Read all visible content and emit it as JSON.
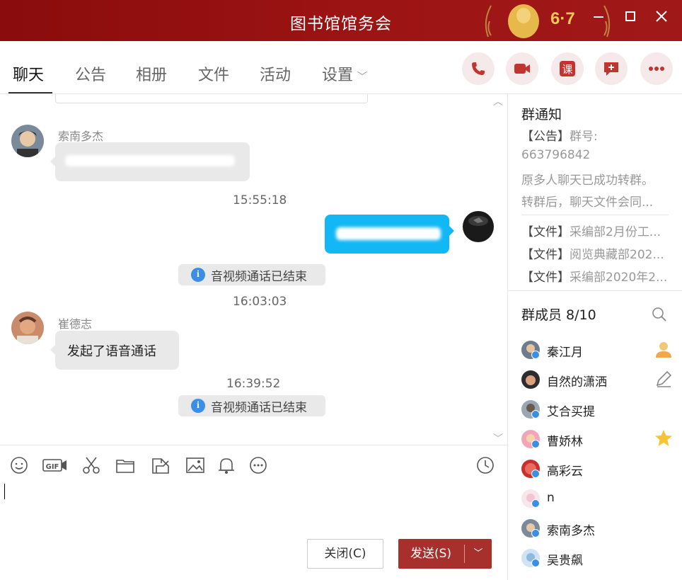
{
  "window": {
    "title": "图书馆馆务会",
    "badge": "6·7"
  },
  "tabs": [
    {
      "label": "聊天"
    },
    {
      "label": "公告"
    },
    {
      "label": "相册"
    },
    {
      "label": "文件"
    },
    {
      "label": "活动"
    },
    {
      "label": "设置"
    }
  ],
  "chat": {
    "messages": [
      {
        "sender": "索南多杰"
      },
      {
        "time": "15:55:18"
      },
      {
        "system": "音视频通话已结束"
      },
      {
        "time": "16:03:03"
      },
      {
        "sender": "崔德志",
        "text": "发起了语音通话"
      },
      {
        "time": "16:39:52"
      },
      {
        "system": "音视频通话已结束"
      }
    ]
  },
  "composer": {
    "close_label": "关闭(C)",
    "send_label": "发送(S)"
  },
  "notice": {
    "title": "群通知",
    "lines": [
      {
        "tag": "【公告】",
        "text": "群号:"
      },
      {
        "tag": "",
        "text": "663796842"
      },
      {
        "tag": "",
        "text": "原多人聊天已成功转群。"
      },
      {
        "tag": "",
        "text": "转群后，聊天文件会同..."
      }
    ],
    "files": [
      {
        "tag": "【文件】",
        "text": "采编部2月份工..."
      },
      {
        "tag": "【文件】",
        "text": "阅览典藏部202..."
      },
      {
        "tag": "【文件】",
        "text": "采编部2020年2..."
      }
    ]
  },
  "members": {
    "title": "群成员 8/10",
    "list": [
      {
        "name": "秦江月",
        "role": "owner"
      },
      {
        "name": "自然的潇洒",
        "role": "editor"
      },
      {
        "name": "艾合买提",
        "role": ""
      },
      {
        "name": "曹娇林",
        "role": "star"
      },
      {
        "name": "高彩云",
        "role": ""
      },
      {
        "name": "n",
        "role": ""
      },
      {
        "name": "索南多杰",
        "role": ""
      },
      {
        "name": "吴贵飙",
        "role": ""
      }
    ]
  },
  "colors": {
    "titlebar": "#9d1414",
    "accent": "#a8302c",
    "bubble_blue": "#12b7f5",
    "bubble_gray": "#e9e9e9"
  }
}
